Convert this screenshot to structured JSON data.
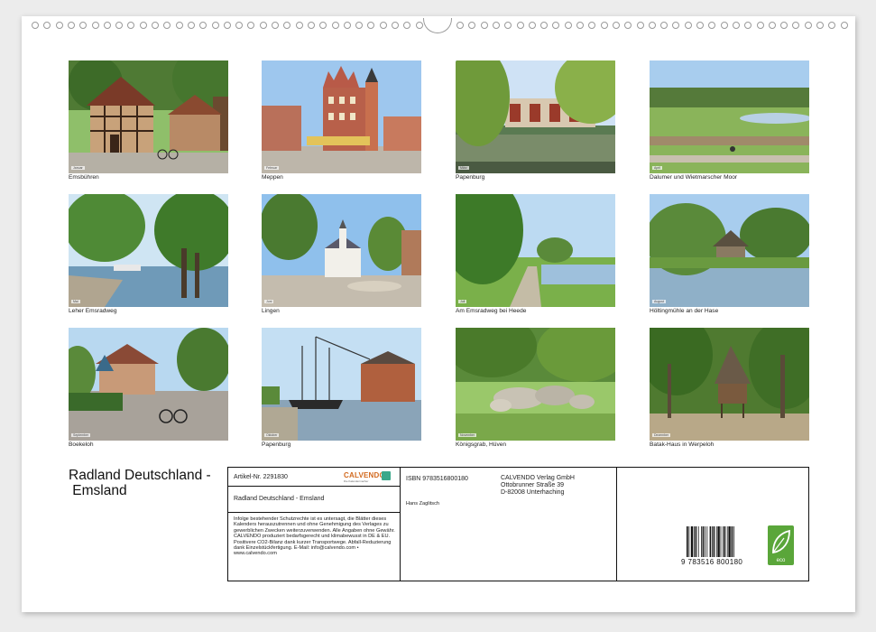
{
  "calendar_title": "Radland Deutschland -\n Emsland",
  "photos": [
    {
      "caption": "Emsbühren",
      "month": "Januar"
    },
    {
      "caption": "Meppen",
      "month": "Februar"
    },
    {
      "caption": "Papenburg",
      "month": "März"
    },
    {
      "caption": "Dalumer und Wietmarscher Moor",
      "month": "April"
    },
    {
      "caption": "Leher Emsradweg",
      "month": "Mai"
    },
    {
      "caption": "Lingen",
      "month": "Juni"
    },
    {
      "caption": "Am Emsradweg bei Heede",
      "month": "Juli"
    },
    {
      "caption": "Höltingmühle an der Hase",
      "month": "August"
    },
    {
      "caption": "Boekeloh",
      "month": "September"
    },
    {
      "caption": "Papenburg",
      "month": "Oktober"
    },
    {
      "caption": "Königsgrab, Hüven",
      "month": "November"
    },
    {
      "caption": "Batak-Haus in Werpeloh",
      "month": "Dezember"
    }
  ],
  "info": {
    "article": "Artikel-Nr. 2291830",
    "publisher_logo": "CALVENDO",
    "publisher_logo_sub": "Die Kalendermacher",
    "product_title": "Radland Deutschland - Emsland",
    "legal": "Infolge bestehender Schutzrechte ist es untersagt, die Blätter dieses Kalenders herauszutrennen und ohne Genehmigung des Verlages zu gewerblichen Zwecken weiterzuverwenden. Alle Angaben ohne Gewähr. CALVENDO produziert bedarfsgerecht und klimabewusst in DE & EU. Positivere CO2-Bilanz dank kurzer Transportwege. Abfall-Reduzierung dank Einzelstückfertigung. E-Mail: info@calvendo.com • www.calvendo.com",
    "isbn": "ISBN 9783516800180",
    "author": "Hans Zaglitsch",
    "company": "CALVENDO Verlag GmbH",
    "street": "Ottobrunner Straße 39",
    "city": "D-82008 Unterhaching",
    "barcode_number": "9 783516 800180",
    "eco_label": "eco"
  },
  "colors": {
    "eco_green": "#5aa63a",
    "calvendo_orange": "#d2691e",
    "calvendo_teal": "#3aa88a"
  }
}
